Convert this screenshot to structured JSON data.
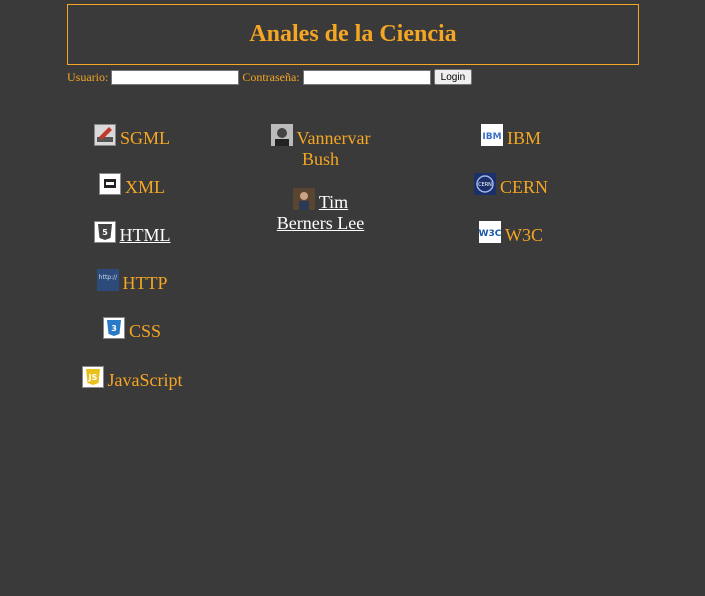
{
  "header": {
    "title": "Anales de la Ciencia"
  },
  "login": {
    "user_label": "Usuario:",
    "user_value": "",
    "password_label": "Contraseña:",
    "password_value": "",
    "button_label": "Login"
  },
  "columns": {
    "languages": [
      {
        "label": "SGML",
        "icon": "sgml-icon"
      },
      {
        "label": "XML",
        "icon": "xml-icon"
      },
      {
        "label": "HTML",
        "icon": "html5-icon"
      },
      {
        "label": "HTTP",
        "icon": "http-icon"
      },
      {
        "label": "CSS",
        "icon": "css3-icon"
      },
      {
        "label": "JavaScript",
        "icon": "javascript-icon"
      }
    ],
    "people": [
      {
        "label": "Vannervar Bush",
        "icon": "vannevar-bush-photo-icon"
      },
      {
        "label": "Tim Berners Lee",
        "icon": "tim-berners-lee-photo-icon"
      }
    ],
    "organizations": [
      {
        "label": "IBM",
        "icon": "ibm-logo-icon"
      },
      {
        "label": "CERN",
        "icon": "cern-logo-icon"
      },
      {
        "label": "W3C",
        "icon": "w3c-logo-icon"
      }
    ]
  },
  "colors": {
    "accent": "#f5a623",
    "background": "#3a3a3a",
    "visited_link": "#ffffff"
  }
}
